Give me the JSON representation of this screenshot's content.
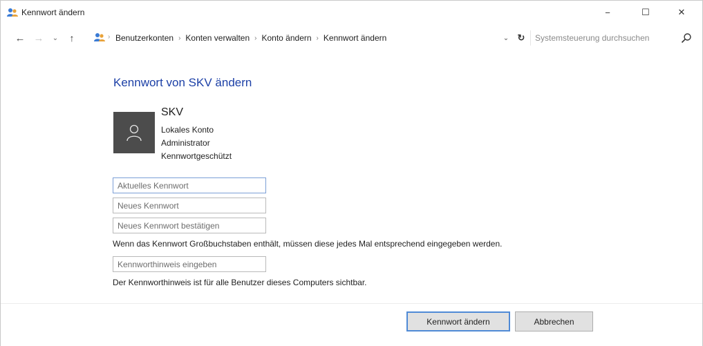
{
  "window": {
    "title": "Kennwort ändern",
    "controls": {
      "minimize": "−",
      "maximize": "☐",
      "close": "✕"
    }
  },
  "navigation": {
    "back": "←",
    "forward": "→",
    "recent": "⌄",
    "up": "↑",
    "breadcrumbs": [
      "Benutzerkonten",
      "Konten verwalten",
      "Konto ändern",
      "Kennwort ändern"
    ],
    "dropdown": "⌄",
    "refresh": "↻",
    "search_placeholder": "Systemsteuerung durchsuchen"
  },
  "main": {
    "heading": "Kennwort von SKV ändern",
    "user": {
      "name": "SKV",
      "account_type": "Lokales Konto",
      "role": "Administrator",
      "protection": "Kennwortgeschützt"
    },
    "fields": {
      "current_password_placeholder": "Aktuelles Kennwort",
      "new_password_placeholder": "Neues Kennwort",
      "confirm_password_placeholder": "Neues Kennwort bestätigen",
      "hint_placeholder": "Kennworthinweis eingeben"
    },
    "case_note": "Wenn das Kennwort Großbuchstaben enthält, müssen diese jedes Mal entsprechend eingegeben werden.",
    "hint_note": "Der Kennworthinweis ist für alle Benutzer dieses Computers sichtbar."
  },
  "buttons": {
    "change": "Kennwort ändern",
    "cancel": "Abbrechen"
  },
  "colors": {
    "heading": "#1b3fa6",
    "avatar_bg": "#4c4c4c",
    "primary_border": "#4f8ad6",
    "button_bg": "#e1e1e1"
  },
  "icons": {
    "title": "users-icon",
    "breadcrumb": "users-icon",
    "avatar": "user-silhouette-icon",
    "search": "search-icon"
  }
}
